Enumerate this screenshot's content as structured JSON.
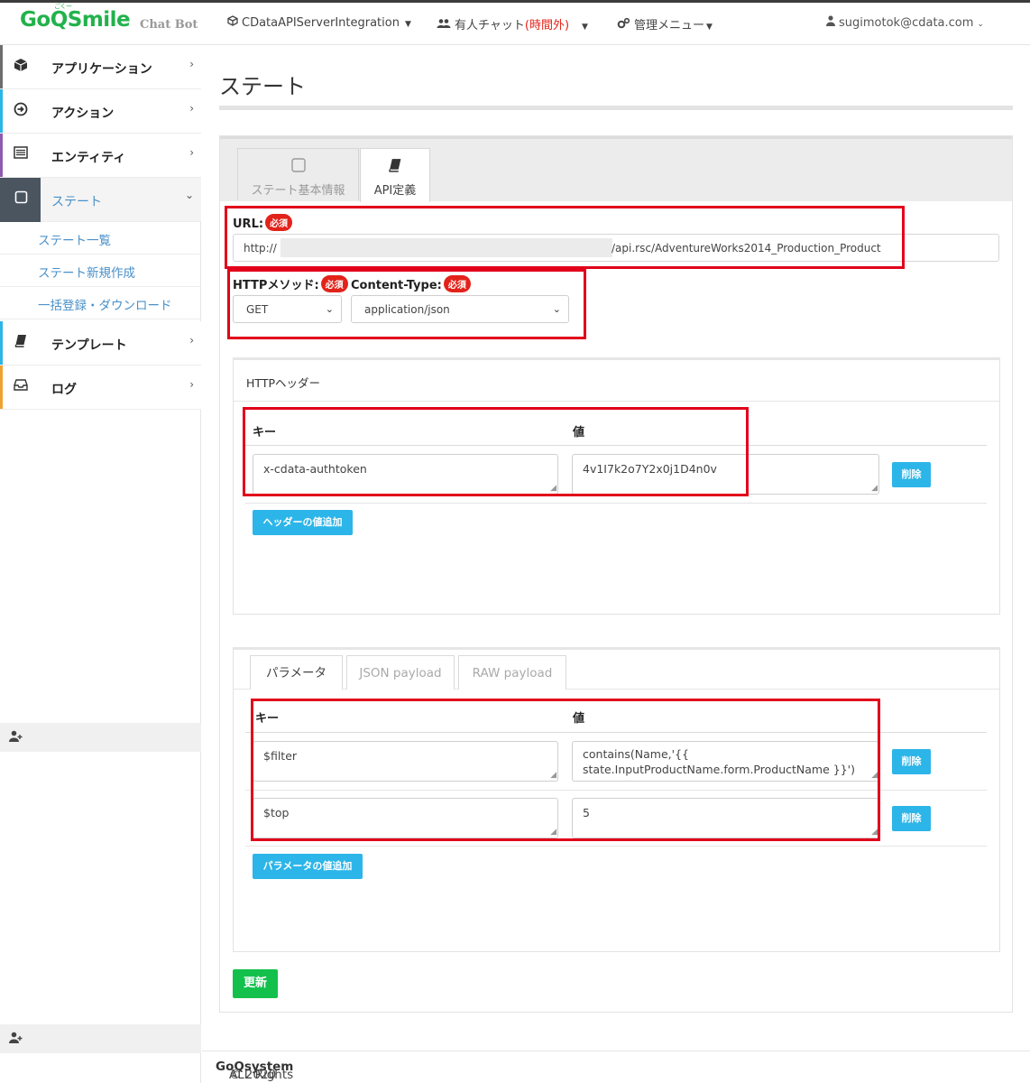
{
  "brand": {
    "logo_go": "Go",
    "logo_q": "Q",
    "logo_smile": "Smile",
    "logo_ruby": "ごくー",
    "subtitle": "Chat Bot"
  },
  "nav": {
    "project": "CDataAPIServerIntegration",
    "chat_prefix": "有人チャット",
    "chat_status": "(時間外)",
    "admin": "管理メニュー",
    "user": "sugimotok@cdata.com"
  },
  "sidebar": {
    "items": [
      {
        "label": "アプリケーション",
        "icon": "cube-icon",
        "color": "#6d6d6d"
      },
      {
        "label": "アクション",
        "icon": "arrow-circle-icon",
        "color": "#29b6e8"
      },
      {
        "label": "エンティティ",
        "icon": "list-icon",
        "color": "#8e5bb0"
      },
      {
        "label": "ステート",
        "icon": "square-icon",
        "color": "#4a5560"
      },
      {
        "label": "テンプレート",
        "icon": "book-icon",
        "color": "#2cb5e8"
      },
      {
        "label": "ログ",
        "icon": "inbox-icon",
        "color": "#f0a030"
      }
    ],
    "state_sub": [
      "ステート一覧",
      "ステート新規作成",
      "一括登録・ダウンロード"
    ]
  },
  "page": {
    "title": "ステート",
    "tabs": [
      {
        "label": "ステート基本情報",
        "icon": "square-icon"
      },
      {
        "label": "API定義",
        "icon": "book-icon"
      }
    ],
    "url_label": "URL:",
    "required": "必須",
    "url_prefix": "http://",
    "url_suffix": "/api.rsc/AdventureWorks2014_Production_Product",
    "method_label": "HTTPメソッド:",
    "method_value": "GET",
    "content_type_label": "Content-Type:",
    "content_type_value": "application/json",
    "headers": {
      "title": "HTTPヘッダー",
      "col_key": "キー",
      "col_value": "値",
      "rows": [
        {
          "key": "x-cdata-authtoken",
          "value": "4v1I7k2o7Y2x0j1D4n0v"
        }
      ],
      "delete": "削除",
      "add": "ヘッダーの値追加"
    },
    "params": {
      "tabs": [
        "パラメータ",
        "JSON payload",
        "RAW payload"
      ],
      "col_key": "キー",
      "col_value": "値",
      "rows": [
        {
          "key": "$filter",
          "value_line1": "contains(Name,'{{",
          "value_line2": "state.InputProductName.form.ProductName }}')"
        },
        {
          "key": "$top",
          "value_line1": "5"
        }
      ],
      "delete": "削除",
      "add": "パラメータの値追加"
    },
    "save": "更新"
  },
  "footer": {
    "prefix": "© 2020 ",
    "company": "GoQsystem",
    "suffix": " ALL Rights Reserved."
  },
  "colors": {
    "accent": "#2cb5e8",
    "save": "#13c04c",
    "required": "#e2231a",
    "highlight": "#e2001a"
  }
}
